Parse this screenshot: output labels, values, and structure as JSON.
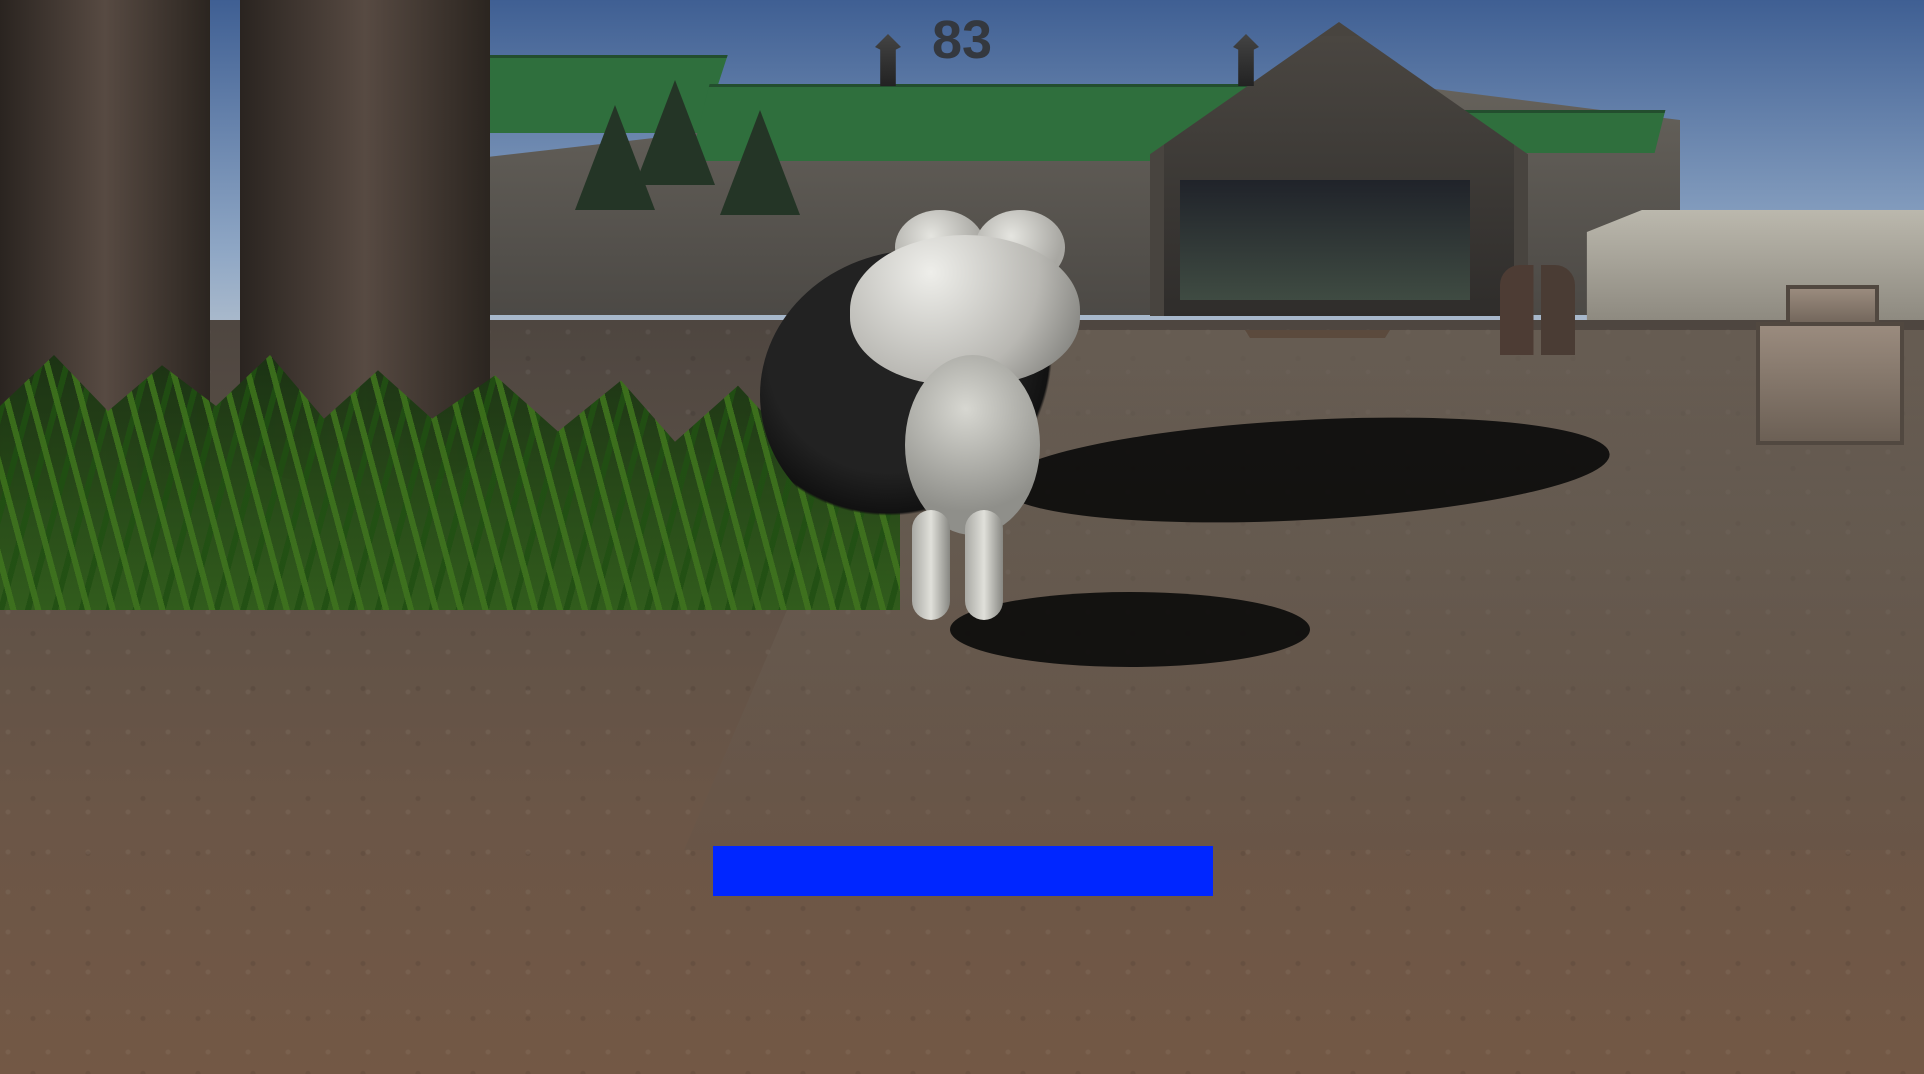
{
  "hud": {
    "counter": "83",
    "health_percent": 100,
    "health_color": "#0026ff"
  },
  "scene": {
    "environment": "campground",
    "character": "frog",
    "sky_color": "#7f9fca",
    "ground_color": "#6b5647",
    "roof_color": "#2f6f3d"
  }
}
